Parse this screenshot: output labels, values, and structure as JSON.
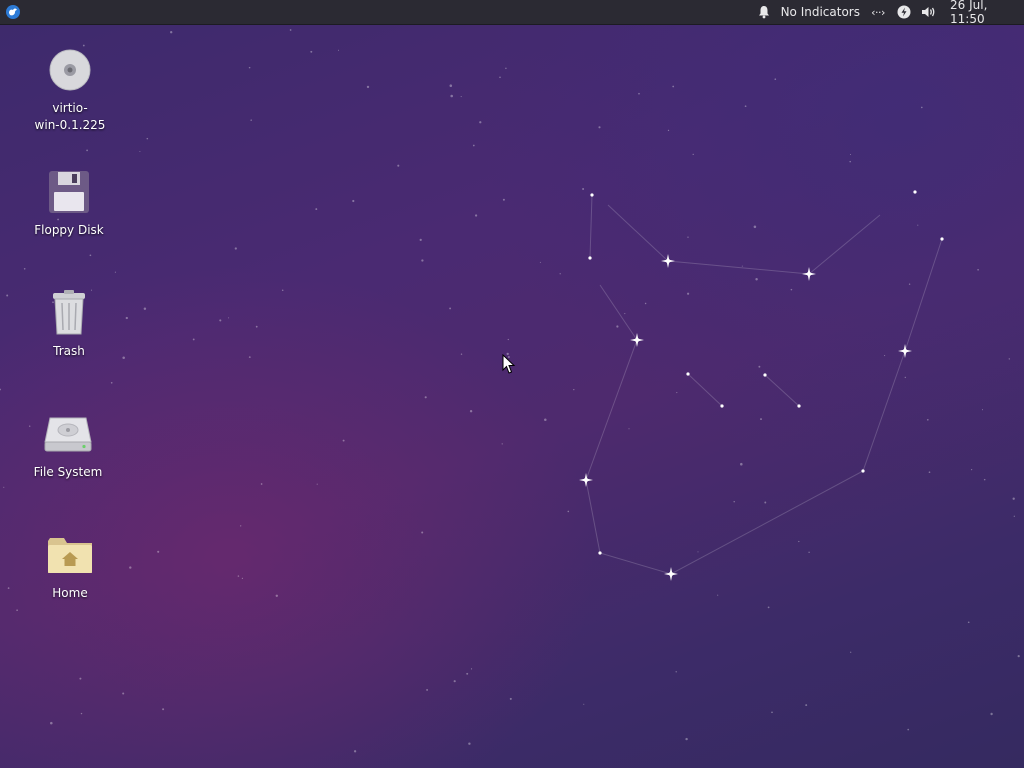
{
  "panel": {
    "notifications_label": "No Indicators",
    "clock": "26 Jul, 11:50",
    "network_glyph": "‹··›",
    "icons": [
      "whisker-menu-icon",
      "bell-icon",
      "network-icon",
      "power-icon",
      "volume-icon"
    ]
  },
  "desktop": {
    "icons": [
      {
        "label": "virtio-\nwin-0.1.225",
        "line1": "virtio-",
        "line2": "win-0.1.225",
        "icon": "optical-disc-icon"
      },
      {
        "label": "Floppy Disk",
        "icon": "floppy-disk-icon"
      },
      {
        "label": "Trash",
        "icon": "trash-icon"
      },
      {
        "label": "File System",
        "icon": "hard-drive-icon"
      },
      {
        "label": "Home",
        "icon": "home-folder-icon"
      }
    ]
  },
  "colors": {
    "panel_bg": "#2b2a33",
    "wallpaper_purple": "#4a2a72",
    "text": "#ffffff"
  }
}
